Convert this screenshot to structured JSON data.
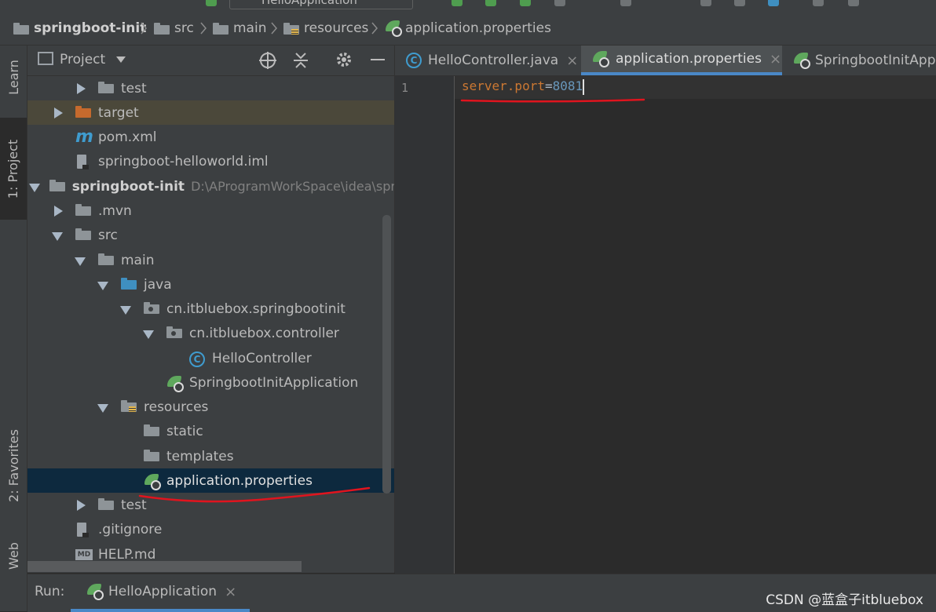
{
  "toolbar": {
    "run_config": "HelloApplication"
  },
  "breadcrumb": [
    "springboot-init",
    "src",
    "main",
    "resources",
    "application.properties"
  ],
  "left_strip": {
    "learn": "Learn",
    "project": "1: Project",
    "favorites": "2: Favorites",
    "web": "Web"
  },
  "project_panel": {
    "title": "Project",
    "items": [
      {
        "label": "test",
        "icon": "folder-icon",
        "arrow": "collapsed"
      },
      {
        "label": "target",
        "icon": "folder-orange-icon",
        "arrow": "collapsed"
      },
      {
        "label": "pom.xml",
        "icon": "maven-icon"
      },
      {
        "label": "springboot-helloworld.iml",
        "icon": "file-icon"
      },
      {
        "label": "springboot-init",
        "path": "D:\\AProgramWorkSpace\\idea\\spr",
        "icon": "module-icon",
        "arrow": "expanded"
      },
      {
        "label": ".mvn",
        "icon": "folder-icon",
        "arrow": "collapsed"
      },
      {
        "label": "src",
        "icon": "folder-icon",
        "arrow": "expanded"
      },
      {
        "label": "main",
        "icon": "folder-icon",
        "arrow": "expanded"
      },
      {
        "label": "java",
        "icon": "folder-blue-icon",
        "arrow": "expanded"
      },
      {
        "label": "cn.itbluebox.springbootinit",
        "icon": "package-icon",
        "arrow": "expanded"
      },
      {
        "label": "cn.itbluebox.controller",
        "icon": "package-icon",
        "arrow": "expanded"
      },
      {
        "label": "HelloController",
        "icon": "class-icon"
      },
      {
        "label": "SpringbootInitApplication",
        "icon": "spring-boot-icon"
      },
      {
        "label": "resources",
        "icon": "resources-folder-icon",
        "arrow": "expanded"
      },
      {
        "label": "static",
        "icon": "folder-icon"
      },
      {
        "label": "templates",
        "icon": "folder-icon"
      },
      {
        "label": "application.properties",
        "icon": "spring-properties-icon",
        "selected": true
      },
      {
        "label": "test",
        "icon": "folder-icon",
        "arrow": "collapsed"
      },
      {
        "label": ".gitignore",
        "icon": "file-icon"
      },
      {
        "label": "HELP.md",
        "icon": "markdown-icon"
      }
    ]
  },
  "editor": {
    "tabs": [
      {
        "label": "HelloController.java",
        "icon": "class-icon",
        "close": "×"
      },
      {
        "label": "application.properties",
        "icon": "spring-properties-icon",
        "close": "×",
        "active": true
      },
      {
        "label": "SpringbootInitAppl",
        "icon": "spring-boot-icon"
      }
    ],
    "line_number": "1",
    "code": {
      "key": "server.port",
      "eq": "=",
      "value": "8081"
    }
  },
  "run_bar": {
    "label": "Run:",
    "tab": "HelloApplication",
    "close": "×"
  },
  "watermark": "CSDN @蓝盒子itbluebox",
  "colors": {
    "accent": "#4a88c7",
    "keyword": "#cc7832",
    "number": "#6897bb",
    "annotation": "#e0141e"
  }
}
